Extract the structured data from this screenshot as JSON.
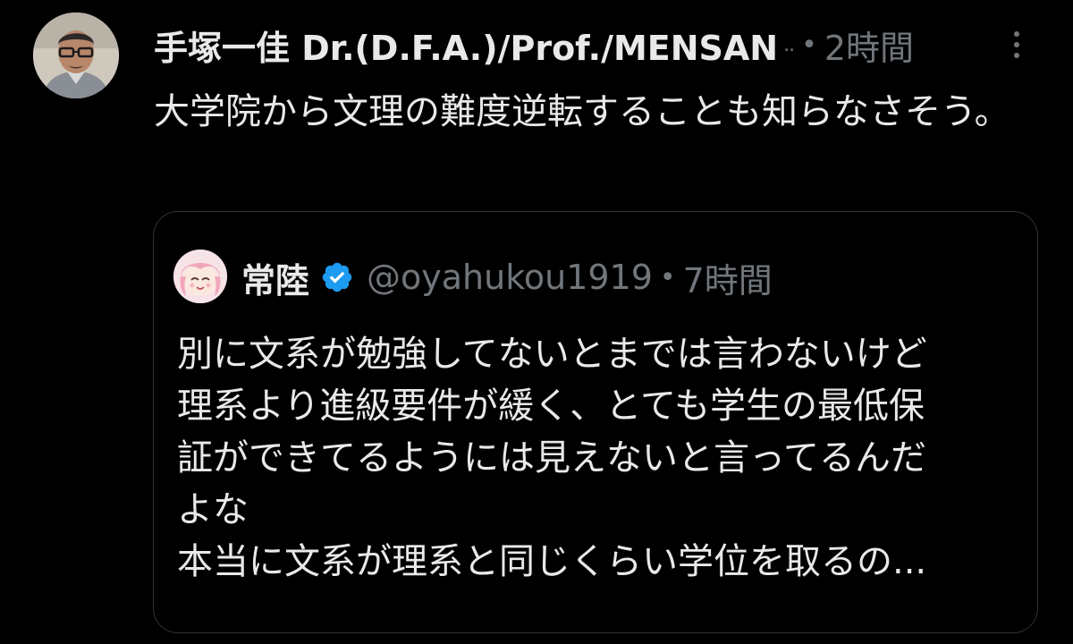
{
  "tweet": {
    "author": {
      "display_name": "手塚一佳 Dr.(D.F.A.)/Prof./MENSAN",
      "truncation": "..",
      "avatar_icon": "person-avatar"
    },
    "separator": "•",
    "timestamp": "2時間",
    "more_icon": "more-vertical-icon",
    "text": "大学院から文理の難度逆転することも知らなさそう。"
  },
  "quoted_tweet": {
    "author": {
      "display_name": "常陸",
      "handle": "@oyahukou1919",
      "verified": true,
      "avatar_icon": "anime-avatar"
    },
    "separator": "•",
    "timestamp": "7時間",
    "lines": [
      "別に文系が勉強してないとまでは言わないけど",
      "理系より進級要件が緩く、とても学生の最低保",
      "証ができてるようには見えないと言ってるんだ",
      "よな",
      "本当に文系が理系と同じくらい学位を取るの..."
    ]
  },
  "colors": {
    "background": "#000000",
    "text_primary": "#e7e9ea",
    "text_secondary": "#71767b",
    "verified_blue": "#1d9bf0",
    "border": "#2f3336"
  }
}
